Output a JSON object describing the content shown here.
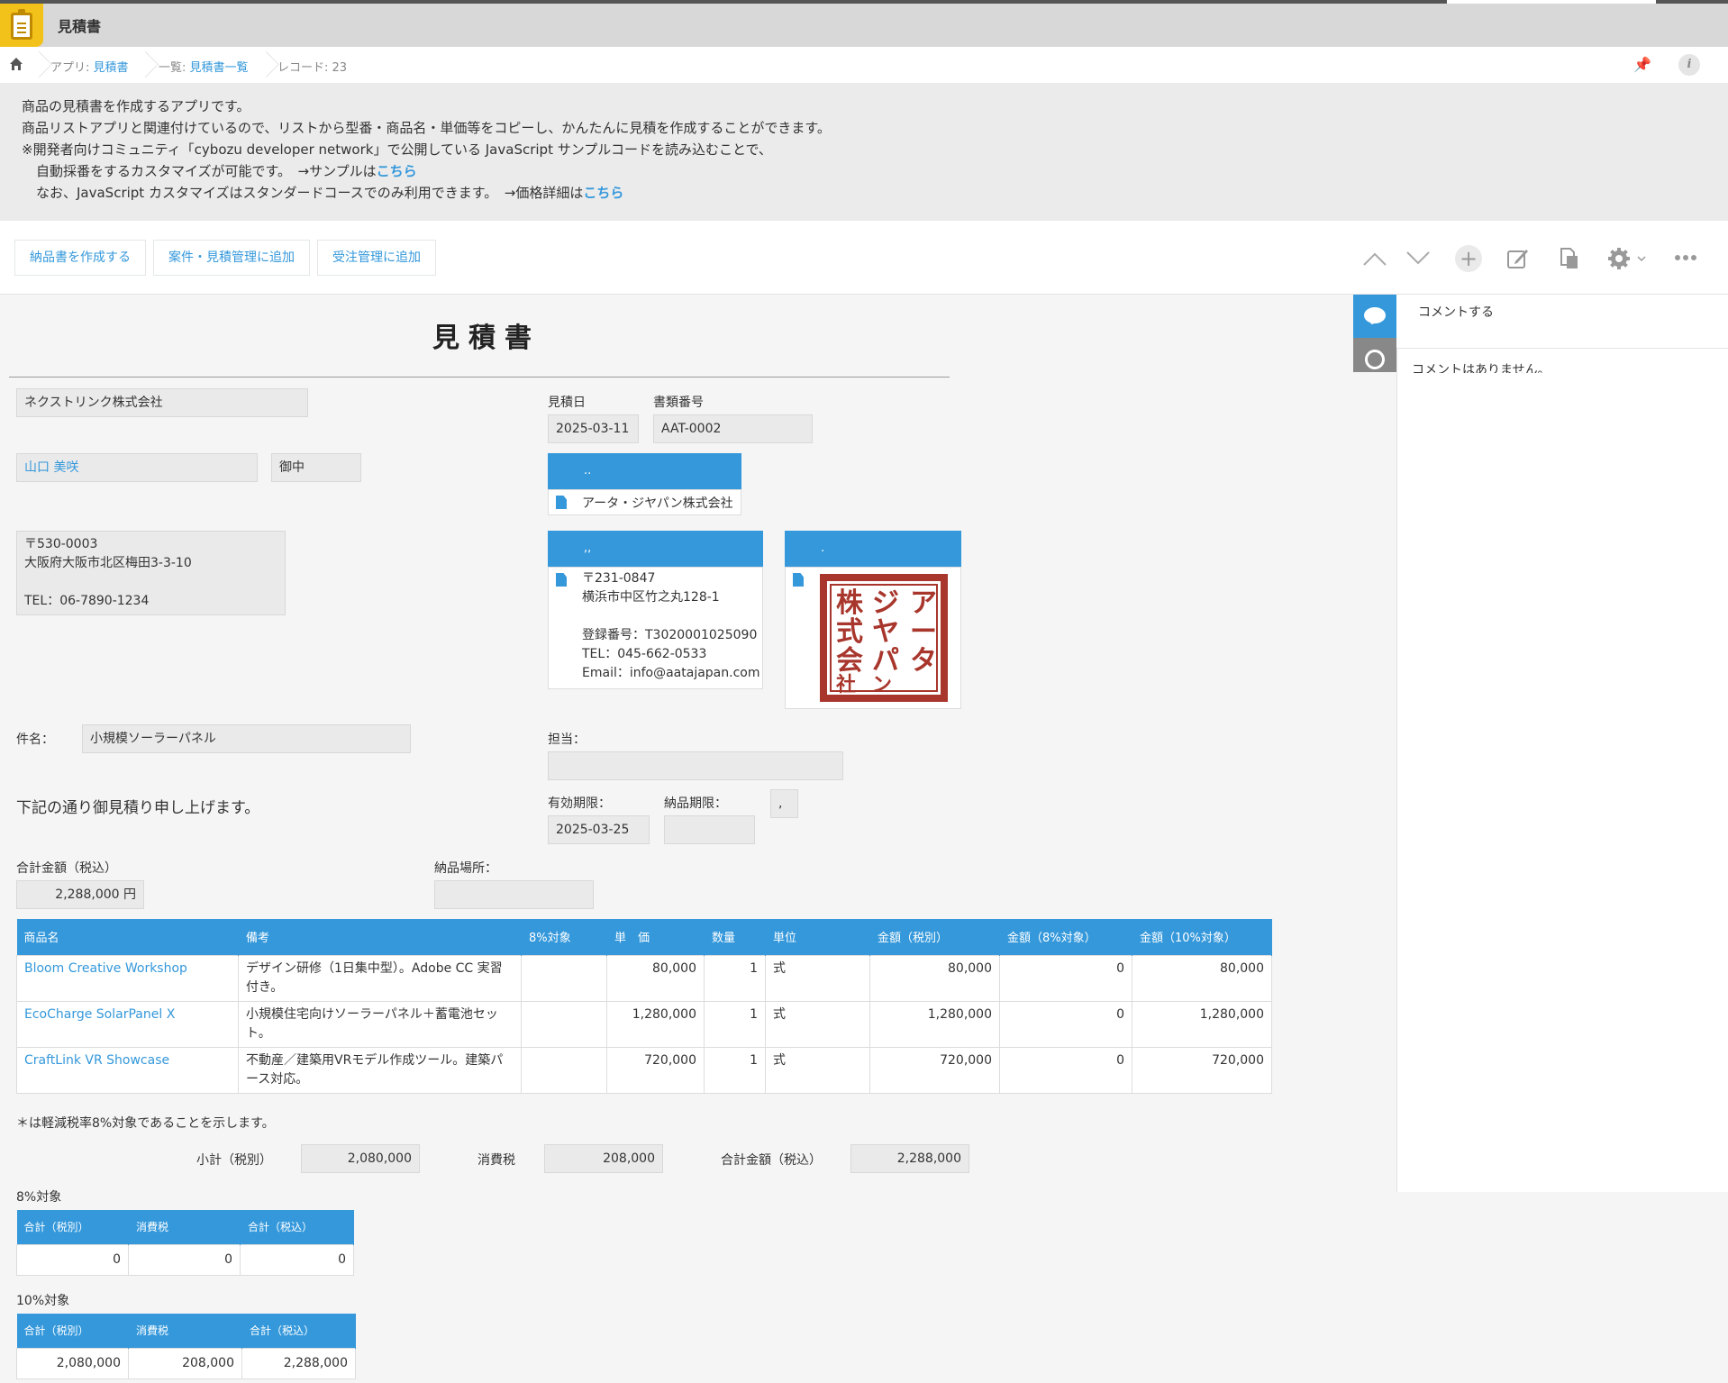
{
  "app": {
    "title": "見積書"
  },
  "breadcrumb": {
    "app_prefix": "アプリ: ",
    "app_name": "見積書",
    "list_prefix": "一覧: ",
    "list_name": "見積書一覧",
    "record": "レコード: 23"
  },
  "description": {
    "line1": "商品の見積書を作成するアプリです。",
    "line2": "商品リストアプリと関連付けているので、リストから型番・商品名・単価等をコピーし、かんたんに見積を作成することができます。",
    "line3": "※開発者向けコミュニティ「cybozu developer network」で公開している JavaScript サンプルコードを読み込むことで、",
    "line4_text": "自動採番をするカスタマイズが可能です。　→サンプルは",
    "line4_link": "こちら",
    "line5_text": "なお、JavaScript カスタマイズはスタンダードコースでのみ利用できます。　→価格詳細は",
    "line5_link": "こちら"
  },
  "toolbar": {
    "btn_delivery": "納品書を作成する",
    "btn_case": "案件・見積管理に追加",
    "btn_order": "受注管理に追加"
  },
  "sidebar": {
    "comment_button": "コメントする",
    "no_comments": "コメントはありません。"
  },
  "form": {
    "doc_title": "見積書",
    "customer_company": "ネクストリンク株式会社",
    "customer_person": "山口 美咲",
    "honorific": "御中",
    "customer_address": "〒530-0003\n大阪府大阪市北区梅田3-3-10\n\nTEL：06-7890-1234",
    "estimate_date_label": "見積日",
    "estimate_date": "2025-03-11",
    "doc_number_label": "書類番号",
    "doc_number": "AAT-0002",
    "ref1_header": "..",
    "ref1_value": "アータ・ジヤパン株式会社",
    "ref2_header": ",,",
    "ref2_value": "〒231-0847\n横浜市中区竹之丸128-1\n\n登録番号：T3020001025090\nTEL：045-662-0533\nEmail：info@aatajapan.com",
    "ref3_header": ".",
    "subject_label": "件名：",
    "subject": "小規模ソーラーパネル",
    "staff_label": "担当：",
    "staff": "",
    "greeting": "下記の通り御見積り申し上げます。",
    "valid_label": "有効期限：",
    "valid_date": "2025-03-25",
    "delivery_limit_label": "納品期限：",
    "delivery_limit": "",
    "small_field": ",",
    "total_label": "合計金額（税込）",
    "total": "2,288,000 円",
    "place_label": "納品場所：",
    "place": ""
  },
  "items_table": {
    "headers": [
      "商品名",
      "備考",
      "8%対象",
      "単　価",
      "数量",
      "単位",
      "金額（税別）",
      "金額（8%対象）",
      "金額（10%対象）"
    ],
    "rows": [
      [
        "Bloom Creative Workshop",
        "デザイン研修（1日集中型）。Adobe CC 実習付き。",
        "",
        "80,000",
        "1",
        "式",
        "80,000",
        "0",
        "80,000"
      ],
      [
        "EcoCharge SolarPanel X",
        "小規模住宅向けソーラーパネル＋蓄電池セット。",
        "",
        "1,280,000",
        "1",
        "式",
        "1,280,000",
        "0",
        "1,280,000"
      ],
      [
        "CraftLink VR Showcase",
        "不動産／建築用VRモデル作成ツール。建築パース対応。",
        "",
        "720,000",
        "1",
        "式",
        "720,000",
        "0",
        "720,000"
      ]
    ]
  },
  "summary": {
    "note": "＊は軽減税率8%対象であることを示します。",
    "subtotal_label": "小計（税別）",
    "subtotal": "2,080,000",
    "tax_label": "消費税",
    "tax": "208,000",
    "grand_label": "合計金額（税込）",
    "grand": "2,288,000"
  },
  "tax8": {
    "title": "8%対象",
    "headers": [
      "合計（税別）",
      "消費税",
      "合計（税込）"
    ],
    "values": [
      "0",
      "0",
      "0"
    ]
  },
  "tax10": {
    "title": "10%対象",
    "headers": [
      "合計（税別）",
      "消費税",
      "合計（税込）"
    ],
    "values": [
      "2,080,000",
      "208,000",
      "2,288,000"
    ]
  },
  "colors": {
    "accent": "#3498db",
    "app_icon": "#f2c21a",
    "seal": "#a8362c"
  }
}
